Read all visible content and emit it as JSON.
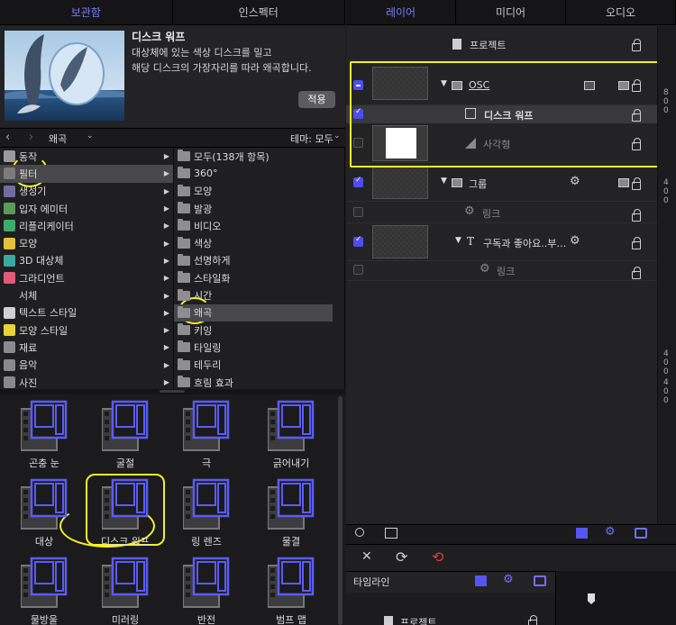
{
  "left_tabs": [
    {
      "label": "보관함",
      "active": true
    },
    {
      "label": "인스펙터",
      "active": false
    }
  ],
  "right_tabs": [
    {
      "label": "레이어",
      "active": true
    },
    {
      "label": "미디어",
      "active": false
    },
    {
      "label": "오디오",
      "active": false
    }
  ],
  "preview": {
    "title": "디스크 워프",
    "desc_line1": "대상체에 있는 색상 디스크를 밀고",
    "desc_line2": "해당 디스크의 가장자리를 따라 왜곡합니다.",
    "apply_label": "적용"
  },
  "nav": {
    "back": "‹",
    "forward": "›",
    "crumb": "왜곡",
    "theme": "테마: 모두"
  },
  "categories": [
    {
      "label": "동작",
      "icon": "gear-icon",
      "color": "#9a9a9a",
      "selected": false
    },
    {
      "label": "필터",
      "icon": "filter-icon",
      "color": "#7b7b7b",
      "selected": true
    },
    {
      "label": "생성기",
      "icon": "generator-icon",
      "color": "#6f6f9f",
      "selected": false
    },
    {
      "label": "입자 에미터",
      "icon": "particle-icon",
      "color": "#5a9a5a",
      "selected": false
    },
    {
      "label": "리플리케이터",
      "icon": "replicator-icon",
      "color": "#3faa6a",
      "selected": false
    },
    {
      "label": "모양",
      "icon": "shape-icon",
      "color": "#e2c23a",
      "selected": false
    },
    {
      "label": "3D 대상체",
      "icon": "3d-object-icon",
      "color": "#3aa7a0",
      "selected": false
    },
    {
      "label": "그라디언트",
      "icon": "gradient-icon",
      "color": "#e05a7a",
      "selected": false
    },
    {
      "label": "서체",
      "icon": "font-icon",
      "color": "#1f1f21",
      "selected": false
    },
    {
      "label": "텍스트 스타일",
      "icon": "text-style-icon",
      "color": "#d0d0d0",
      "selected": false
    },
    {
      "label": "모양 스타일",
      "icon": "shape-style-icon",
      "color": "#e8d23a",
      "selected": false
    },
    {
      "label": "재료",
      "icon": "material-icon",
      "color": "#8a8a8e",
      "selected": false
    },
    {
      "label": "음악",
      "icon": "music-icon",
      "color": "#8a8a8e",
      "selected": false
    },
    {
      "label": "사진",
      "icon": "photo-icon",
      "color": "#8a8a8e",
      "selected": false
    }
  ],
  "subcategories": [
    {
      "label": "모두(138개 항목)",
      "selected": false
    },
    {
      "label": "360°",
      "selected": false
    },
    {
      "label": "모양",
      "selected": false
    },
    {
      "label": "발광",
      "selected": false
    },
    {
      "label": "비디오",
      "selected": false
    },
    {
      "label": "색상",
      "selected": false
    },
    {
      "label": "선명하게",
      "selected": false
    },
    {
      "label": "스타일화",
      "selected": false
    },
    {
      "label": "시간",
      "selected": false
    },
    {
      "label": "왜곡",
      "selected": true
    },
    {
      "label": "키잉",
      "selected": false
    },
    {
      "label": "타일링",
      "selected": false
    },
    {
      "label": "테두리",
      "selected": false
    },
    {
      "label": "흐림 효과",
      "selected": false
    }
  ],
  "effects": [
    {
      "label": "곤충 눈"
    },
    {
      "label": "굴절"
    },
    {
      "label": "극"
    },
    {
      "label": "긁어내기"
    },
    {
      "label": "대상"
    },
    {
      "label": "디스크 워프"
    },
    {
      "label": "링 렌즈"
    },
    {
      "label": "물결"
    },
    {
      "label": "물방울"
    },
    {
      "label": "미러링"
    },
    {
      "label": "반전"
    },
    {
      "label": "범프 맵"
    }
  ],
  "layers": {
    "project": "프로젝트",
    "osc": "OSC",
    "disk_warp": "디스크 워프",
    "rectangle": "사각형",
    "group": "그룹",
    "link1": "링크",
    "text_layer": "구독과 좋아요..부…",
    "link2": "링크"
  },
  "ruler": [
    "8",
    "0",
    "0",
    "4",
    "0",
    "0",
    "4",
    "0",
    "0",
    "4",
    "0",
    "0"
  ],
  "timeline": {
    "label": "타임라인",
    "project": "프로젝트"
  }
}
